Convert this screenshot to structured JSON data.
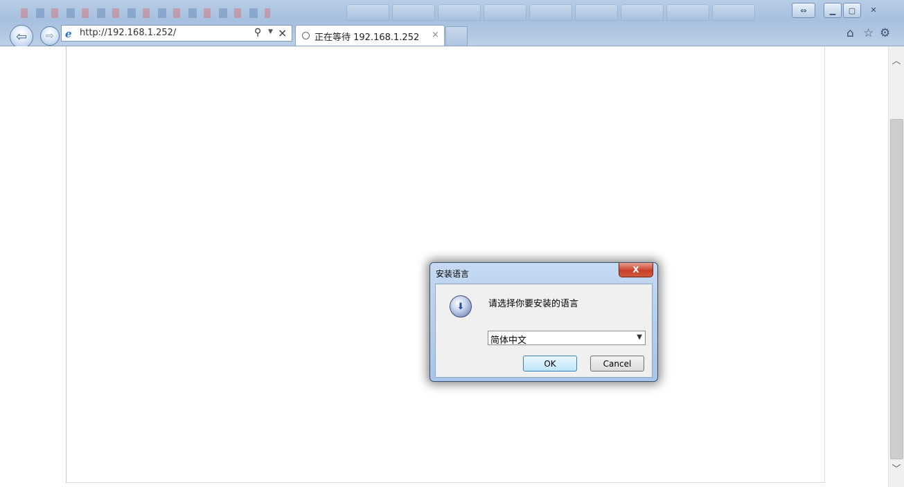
{
  "browser": {
    "address_url": "http://192.168.1.252/",
    "tab_title": "正在等待 192.168.1.252",
    "tab_close": "×",
    "stop_label": "×"
  },
  "dialog": {
    "title": "安装语言",
    "close": "X",
    "message": "请选择你要安装的语言",
    "language_select": "简体中文",
    "ok_label": "OK",
    "cancel_label": "Cancel"
  },
  "icons": {
    "back": "back-arrow-icon",
    "forward": "forward-arrow-icon",
    "ie": "internet-explorer-icon",
    "search": "search-icon",
    "home": "home-icon",
    "favorites": "star-icon",
    "tools": "gear-icon",
    "installer": "installer-disc-icon"
  }
}
